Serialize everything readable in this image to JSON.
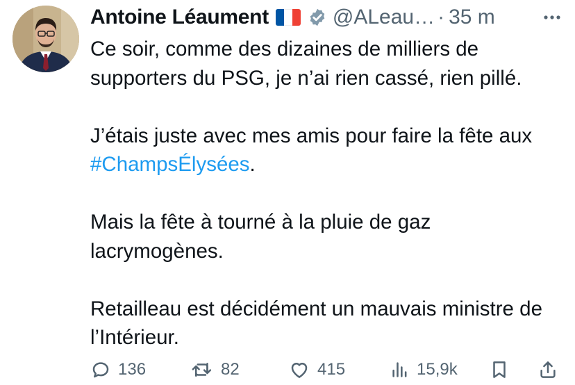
{
  "author": {
    "display_name": "Antoine Léaument",
    "flag_icon": "france-flag-icon",
    "verified_icon": "verified-badge-icon",
    "handle": "@ALeau…",
    "separator": "·",
    "time": "35 m"
  },
  "tweet": {
    "paragraphs": [
      {
        "text": "Ce soir, comme des dizaines de milliers de supporters du PSG, je n’ai rien cassé, rien pillé."
      },
      {
        "text_before": "J’étais juste avec mes amis pour faire la fête aux ",
        "hashtag": "#ChampsÉlysées",
        "text_after": "."
      },
      {
        "text": "Mais la fête à tourné à la pluie de gaz lacrymogènes."
      },
      {
        "text": "Retailleau est décidément un mauvais ministre de l’Intérieur."
      }
    ]
  },
  "actions": {
    "replies": "136",
    "reposts": "82",
    "likes": "415",
    "views": "15,9k"
  },
  "colors": {
    "text": "#0f1419",
    "secondary": "#536471",
    "link": "#1d9bf0"
  }
}
